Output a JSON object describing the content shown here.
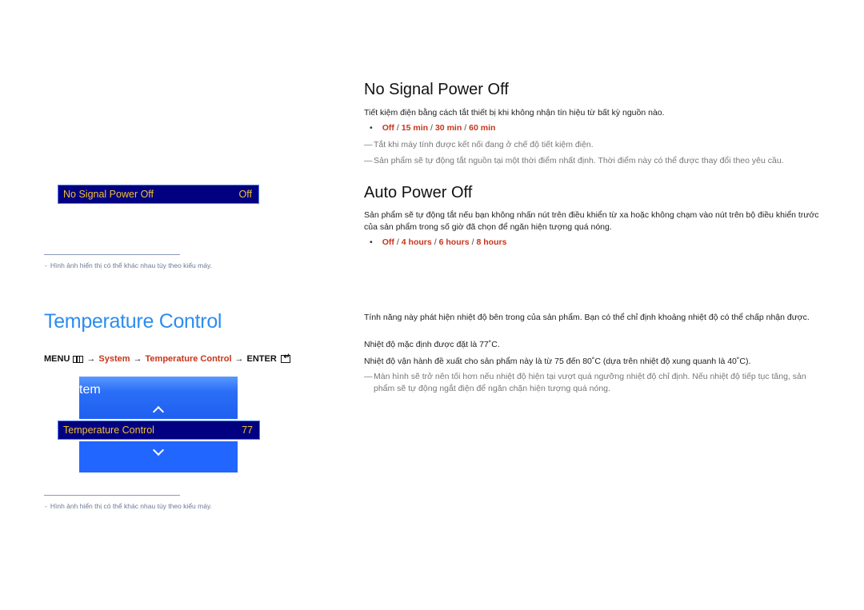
{
  "left": {
    "osd_no_signal": {
      "label": "No Signal Power Off",
      "value": "Off"
    },
    "caption_1": {
      "dash": "-",
      "text": "Hình ảnh hiển thị có thể khác nhau tùy theo kiểu máy."
    },
    "temperature_title": "Temperature Control",
    "menu_path": {
      "menu": "MENU",
      "menu_icon": "menu-grid-icon",
      "arrow": "→",
      "system": "System",
      "temperature_control": "Temperature Control",
      "enter": "ENTER",
      "enter_icon": "enter-icon"
    },
    "osd_system": {
      "panel_title_fragment": "tem",
      "selected_label": "Temperature Control",
      "selected_value": "77"
    },
    "caption_2": {
      "dash": "-",
      "text": "Hình ảnh hiển thị có thể khác nhau tùy theo kiểu máy."
    }
  },
  "right": {
    "no_signal": {
      "title": "No Signal Power Off",
      "description": "Tiết kiệm điện bằng cách tắt thiết bị khi không nhận tín hiệu từ bất kỳ nguồn nào.",
      "options": [
        "Off",
        "15 min",
        "30 min",
        "60 min"
      ],
      "notes": [
        "Tắt khi máy tính được kết nối đang ở chế độ tiết kiệm điện.",
        "Sản phẩm sẽ tự động tắt nguồn tại một thời điểm nhất định. Thời điểm này có thể được thay đổi theo yêu cầu."
      ]
    },
    "auto_power_off": {
      "title": "Auto Power Off",
      "description": "Sản phẩm sẽ tự động tắt nếu bạn không nhấn nút trên điều khiển từ xa hoặc không chạm vào nút trên bộ điều khiển trước của sản phẩm trong số giờ đã chọn để ngăn hiện tượng quá nóng.",
      "options": [
        "Off",
        "4 hours",
        "6 hours",
        "8 hours"
      ]
    },
    "temperature": {
      "paragraphs": [
        "Tính năng này phát hiện nhiệt độ bên trong của sản phẩm. Bạn có thể chỉ định khoảng nhiệt độ có thể chấp nhận được.",
        "Nhiệt độ mặc định được đặt là 77˚C.",
        "Nhiệt độ vận hành đề xuất cho sản phẩm này là từ 75 đến 80˚C (dựa trên nhiệt độ xung quanh là 40˚C)."
      ],
      "note": "Màn hình sẽ trở nên tối hơn nếu nhiệt độ hiện tại vượt quá ngưỡng nhiệt độ chỉ định. Nếu nhiệt độ tiếp tục tăng, sản phẩm sẽ tự động ngắt điện để ngăn chặn hiện tượng quá nóng."
    },
    "bullet_char": "•",
    "option_separator": "/",
    "note_dash": "—"
  },
  "colors": {
    "accent_red": "#c8341a",
    "title_blue": "#2d8cf0",
    "osd_selected_bg": "#000080",
    "osd_selected_text": "#f2c12e",
    "osd_panel_blue": "#1f63f5"
  }
}
